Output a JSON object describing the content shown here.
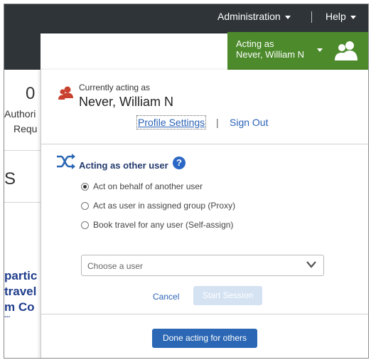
{
  "header": {
    "admin_label": "Administration",
    "help_label": "Help",
    "acting_line1": "Acting as",
    "acting_line2": "Never, William N"
  },
  "background_page": {
    "number_partial": "0",
    "text_authori": "Authori",
    "text_requ": "Requ",
    "text_s": "S",
    "link_1": "partic",
    "link_2": "travel",
    "link_3": "m Co",
    "link_4": "..."
  },
  "panel": {
    "currently_acting_label": "Currently acting as",
    "current_user": "Never, William N",
    "profile_settings": "Profile Settings",
    "separator": "|",
    "sign_out": "Sign Out",
    "section_title": "Acting as other user",
    "help_glyph": "?",
    "options": [
      "Act on behalf of another user",
      "Act as user in assigned group (Proxy)",
      "Book travel for any user (Self-assign)"
    ],
    "selected_option_index": 0,
    "select_placeholder": "Choose a user",
    "cancel_label": "Cancel",
    "start_session_label": "Start Session",
    "done_label": "Done acting for others"
  },
  "colors": {
    "topbar": "#2f3438",
    "acting_green": "#4c8a2b",
    "link_blue": "#2a62b6",
    "primary_button": "#2b67b4",
    "disabled_button": "#d4e2f2",
    "user_icon_red": "#c9412f"
  },
  "icons": [
    "users-icon",
    "user-pin-icon",
    "shuffle-icon",
    "help-icon",
    "chevron-down-icon"
  ]
}
